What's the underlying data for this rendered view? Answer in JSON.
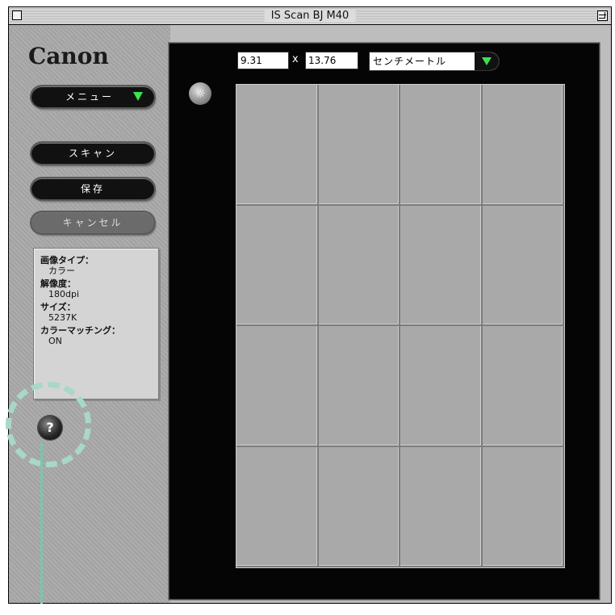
{
  "window": {
    "title": "IS Scan BJ M40"
  },
  "logo": "Canon",
  "buttons": {
    "menu": "メニュー",
    "scan": "スキャン",
    "save": "保存",
    "cancel": "キャンセル"
  },
  "info": {
    "image_type_label": "画像タイプ：",
    "image_type_value": "カラー",
    "resolution_label": "解像度：",
    "resolution_value": "180dpi",
    "size_label": "サイズ：",
    "size_value": "5237K",
    "color_matching_label": "カラーマッチング：",
    "color_matching_value": "ON"
  },
  "dimensions": {
    "width": "9.31",
    "times": "x",
    "height": "13.76",
    "unit": "センチメートル"
  },
  "help_glyph": "?",
  "sun_glyph": "☼",
  "colors": {
    "accent_arrow": "#3fe04f",
    "highlight": "#a8d8c6"
  },
  "icons": [
    "close-box-icon",
    "zoom-box-icon",
    "menu-dropdown-arrow-icon",
    "unit-dropdown-arrow-icon",
    "brightness-sun-icon",
    "help-icon"
  ]
}
